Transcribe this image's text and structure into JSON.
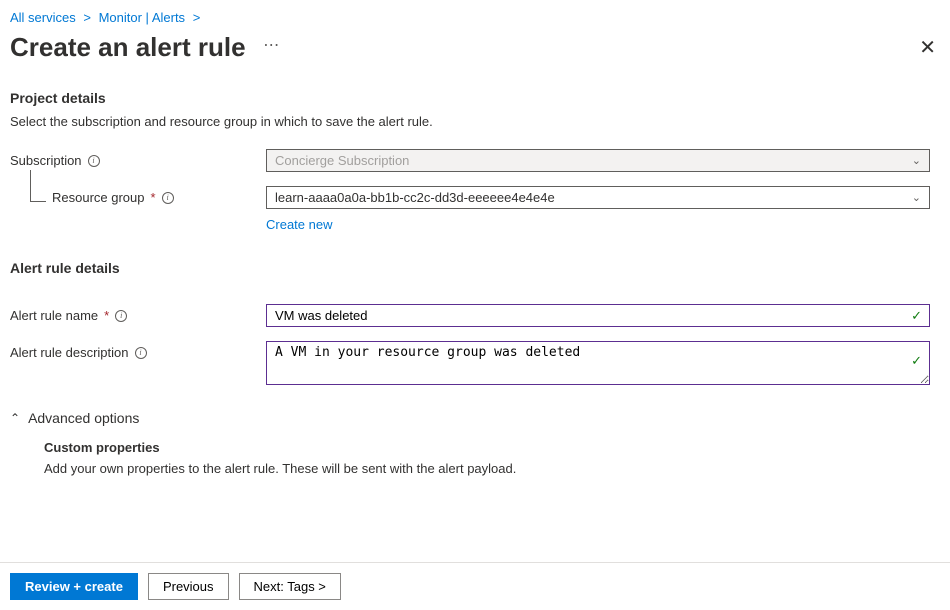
{
  "breadcrumb": {
    "items": [
      "All services",
      "Monitor | Alerts"
    ]
  },
  "header": {
    "title": "Create an alert rule"
  },
  "projectDetails": {
    "title": "Project details",
    "description": "Select the subscription and resource group in which to save the alert rule.",
    "subscription": {
      "label": "Subscription",
      "value": "Concierge Subscription"
    },
    "resourceGroup": {
      "label": "Resource group",
      "value": "learn-aaaa0a0a-bb1b-cc2c-dd3d-eeeeee4e4e4e",
      "createNew": "Create new"
    }
  },
  "alertRuleDetails": {
    "title": "Alert rule details",
    "name": {
      "label": "Alert rule name",
      "value": "VM was deleted"
    },
    "description": {
      "label": "Alert rule description",
      "value": "A VM in your resource group was deleted"
    }
  },
  "advanced": {
    "label": "Advanced options",
    "customProps": {
      "title": "Custom properties",
      "description": "Add your own properties to the alert rule. These will be sent with the alert payload."
    }
  },
  "footer": {
    "reviewCreate": "Review + create",
    "previous": "Previous",
    "nextTags": "Next: Tags >"
  }
}
